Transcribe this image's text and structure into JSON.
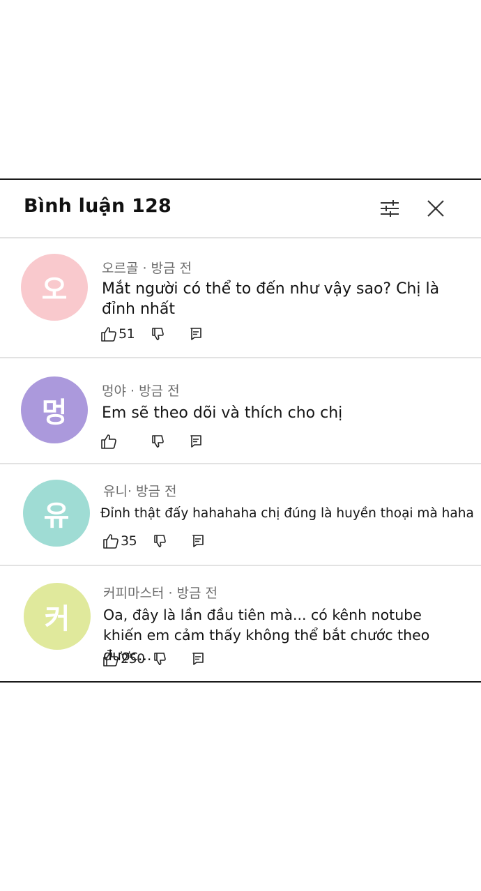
{
  "header": {
    "title": "Bình luận 128",
    "filter_icon": "sliders-icon",
    "close_icon": "close-icon"
  },
  "comments": [
    {
      "avatar_char": "오",
      "avatar_color": "#f9c9cd",
      "meta": "오르골 · 방금 전",
      "text": "Mắt người có thể to đến như vậy sao? Chị là đỉnh nhất",
      "likes": "51"
    },
    {
      "avatar_char": "멍",
      "avatar_color": "#ab99dc",
      "meta": "멍야 · 방금 전",
      "text": "Em sẽ theo dõi và thích cho chị",
      "likes": ""
    },
    {
      "avatar_char": "유",
      "avatar_color": "#9fdcd4",
      "meta": "유니· 방금 전",
      "text": "Đỉnh thật đấy hahahaha chị đúng là huyền thoại mà haha",
      "likes": "35"
    },
    {
      "avatar_char": "커",
      "avatar_color": "#e0e99c",
      "meta": "커피마스터 · 방금 전",
      "text": "Oa, đây là lần đầu tiên mà... có kênh notube khiến em cảm thấy không thể bắt chước theo được...",
      "likes": "250"
    }
  ]
}
